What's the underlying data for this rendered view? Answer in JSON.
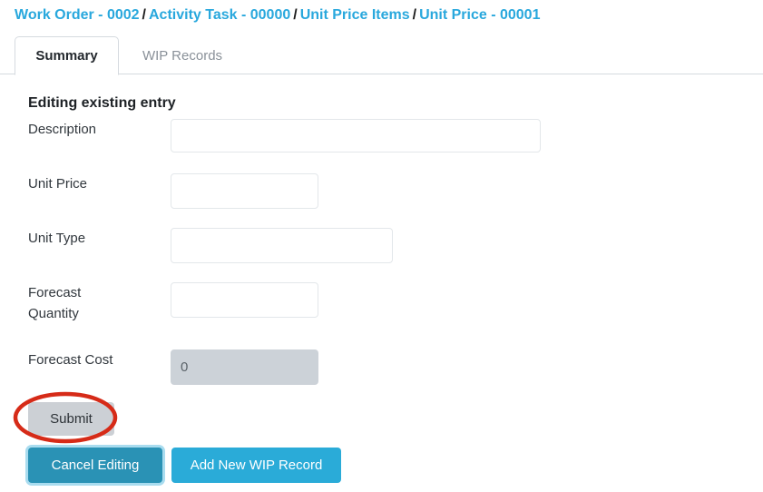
{
  "breadcrumb": {
    "separator": "/",
    "items": [
      {
        "label": "Work Order - 0002"
      },
      {
        "label": "Activity Task - 00000"
      },
      {
        "label": "Unit Price Items"
      },
      {
        "label": "Unit Price - 00001"
      }
    ]
  },
  "tabs": [
    {
      "label": "Summary",
      "active": true
    },
    {
      "label": "WIP Records",
      "active": false
    }
  ],
  "form": {
    "title": "Editing existing entry",
    "fields": [
      {
        "label": "Description",
        "value": "",
        "placeholder": "",
        "disabled": false
      },
      {
        "label": "Unit Price",
        "value": "",
        "placeholder": "",
        "disabled": false
      },
      {
        "label": "Unit Type",
        "value": "",
        "placeholder": "",
        "disabled": false
      },
      {
        "label": "Forecast Quantity",
        "value": "",
        "placeholder": "",
        "disabled": false
      },
      {
        "label": "Forecast Cost",
        "value": "0",
        "placeholder": "",
        "disabled": true
      }
    ]
  },
  "buttons": {
    "submit": "Submit",
    "cancel": "Cancel Editing",
    "add_wip": "Add New WIP Record"
  },
  "annotation": {
    "shape": "ellipse-highlight",
    "target": "Submit",
    "color": "#d62b18"
  },
  "colors": {
    "link": "#29a8dd",
    "tab_active_text": "#23282d",
    "tab_inactive_text": "#8a9199",
    "button_submit_bg": "#ccd0d5",
    "button_cancel_bg": "#2a92b5",
    "button_cancel_ring": "#a9dcef",
    "button_addwip_bg": "#2aabd8",
    "input_border": "#e3e7ea",
    "input_disabled_bg": "#ccd2d8",
    "divider": "#d5dadf",
    "annotation_red": "#d62b18"
  }
}
